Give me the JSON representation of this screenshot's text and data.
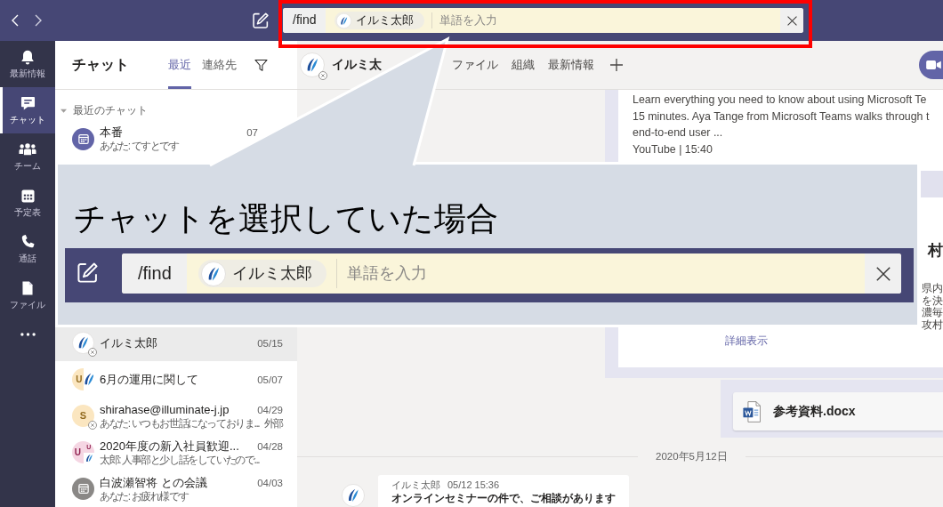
{
  "top_bar": {
    "search": {
      "command": "/find",
      "chip": "イルミ太郎",
      "placeholder": "単語を入力"
    }
  },
  "app_bar": [
    {
      "kind": "activity",
      "label": "最新情報",
      "selected": false
    },
    {
      "kind": "chat",
      "label": "チャット",
      "selected": true
    },
    {
      "kind": "teams",
      "label": "チーム",
      "selected": false
    },
    {
      "kind": "calendar",
      "label": "予定表",
      "selected": false
    },
    {
      "kind": "calls",
      "label": "通話",
      "selected": false
    },
    {
      "kind": "files",
      "label": "ファイル",
      "selected": false
    }
  ],
  "chat_list": {
    "title": "チャット",
    "tabs": [
      {
        "label": "最近",
        "selected": true
      },
      {
        "label": "連絡先",
        "selected": false
      }
    ],
    "section": {
      "label": "最近のチャット",
      "expanded": true
    },
    "items": [
      {
        "name": "本番",
        "preview": "あなた: てすとです",
        "date": "07",
        "selected": false,
        "offline": false,
        "avatar": {
          "kind": "meeting",
          "color": "#6264a7"
        }
      },
      {
        "name": "イルミ太郎",
        "date": "05/15",
        "selected": true,
        "offline": true,
        "avatar": {
          "kind": "logo"
        }
      },
      {
        "name": "6月の運用に関して",
        "date": "05/07",
        "selected": false,
        "offline": false,
        "avatar": {
          "kind": "group",
          "parts": [
            {
              "kind": "initial",
              "text": "U",
              "color": "#fbe6c0"
            },
            {
              "kind": "logo"
            }
          ]
        }
      },
      {
        "name": "shirahase@illuminate-j.jp",
        "preview": "あなた: いつもお世話になっておりま...",
        "date": "04/29",
        "tag": "外部",
        "selected": false,
        "offline": true,
        "avatar": {
          "kind": "initial",
          "text": "S",
          "color": "#fbe6c0"
        }
      },
      {
        "name": "2020年度の新入社員歓迎...",
        "preview": "太郎: 人事部と少し話をしていたので...",
        "date": "04/28",
        "selected": false,
        "offline": false,
        "avatar": {
          "kind": "group",
          "parts": [
            {
              "kind": "initial",
              "text": "U",
              "color": "#f5d6e3"
            },
            {
              "kind": "initial",
              "text": "U",
              "color": "#f5d6e3"
            },
            {
              "kind": "logo"
            }
          ]
        }
      },
      {
        "name": "白波瀬智将 との会議",
        "preview": "あなた: お疲れ様です",
        "date": "04/03",
        "selected": false,
        "offline": false,
        "avatar": {
          "kind": "meeting",
          "color": "#8a8886"
        }
      }
    ]
  },
  "conversation": {
    "name": "イルミ太",
    "offline": true,
    "tabs": [
      "ファイル",
      "組織",
      "最新情報"
    ],
    "link_preview": {
      "description": [
        "Learn everything you need to know about using Microsoft Te",
        "15 minutes. Aya Tange from Microsoft Teams walks through t",
        "end-to-end user ..."
      ],
      "source": "YouTube | 15:40",
      "title_fragment": "村",
      "text_fragments": [
        "県内",
        "を決",
        "濃毎",
        "攻村"
      ],
      "more_link": "詳細表示"
    },
    "attachment": {
      "file_name": "参考資料.docx"
    },
    "date_divider": "2020年5月12日",
    "message": {
      "author": "イルミ太郎",
      "time": "05/12 15:36",
      "text": "オンラインセミナーの件で、ご相談があります"
    }
  },
  "callout": {
    "title": "チャットを選択していた場合",
    "search": {
      "command": "/find",
      "chip": "イルミ太郎",
      "placeholder": "単語を入力"
    }
  }
}
